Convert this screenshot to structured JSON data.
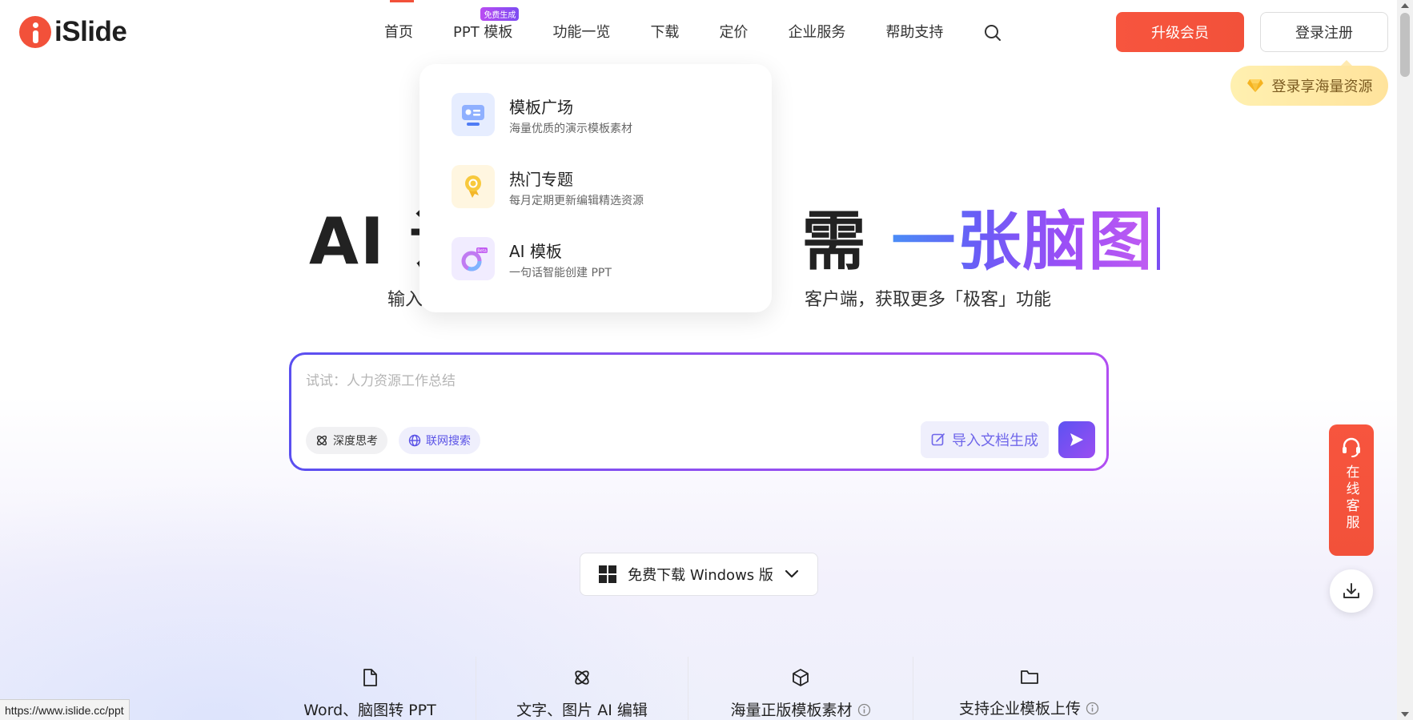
{
  "brand": {
    "name": "iSlide",
    "accent": "#f2513a",
    "purple": "#7a4df2"
  },
  "nav": {
    "items": [
      {
        "label": "首页",
        "active": true
      },
      {
        "label": "PPT 模板",
        "badge": "免费生成"
      },
      {
        "label": "功能一览"
      },
      {
        "label": "下载"
      },
      {
        "label": "定价"
      },
      {
        "label": "企业服务"
      },
      {
        "label": "帮助支持"
      }
    ],
    "search_icon": "search-icon"
  },
  "header": {
    "upgrade_label": "升级会员",
    "login_label": "登录注册",
    "login_tip": "登录享海量资源"
  },
  "dropdown": {
    "items": [
      {
        "title": "模板广场",
        "desc": "海量优质的演示模板素材",
        "icon": "template-plaza-icon"
      },
      {
        "title": "热门专题",
        "desc": "每月定期更新编辑精选资源",
        "icon": "medal-icon"
      },
      {
        "title": "AI 模板",
        "desc": "一句话智能创建 PPT",
        "icon": "ai-template-icon",
        "badge": "Beta"
      }
    ]
  },
  "hero": {
    "title_visible_1": "AI 设",
    "title_visible_2": "需",
    "title_highlight": "一张脑图",
    "subtitle_visible_1": "输入",
    "subtitle_visible_2": "客户端，获取更多「极客」功能"
  },
  "prompt": {
    "placeholder": "试试：人力资源工作总结",
    "chip_think": "深度思考",
    "chip_web": "联网搜索",
    "import_label": "导入文档生成"
  },
  "download": {
    "label": "免费下载 Windows 版"
  },
  "features": [
    {
      "label": "Word、脑图转 PPT",
      "icon": "document-icon"
    },
    {
      "label": "文字、图片 AI 编辑",
      "icon": "atom-icon"
    },
    {
      "label": "海量正版模板素材",
      "icon": "cube-icon",
      "info": true
    },
    {
      "label": "支持企业模板上传",
      "icon": "folder-icon",
      "info": true
    }
  ],
  "side": {
    "service_label": "在线客服"
  },
  "status_url": "https://www.islide.cc/ppt"
}
